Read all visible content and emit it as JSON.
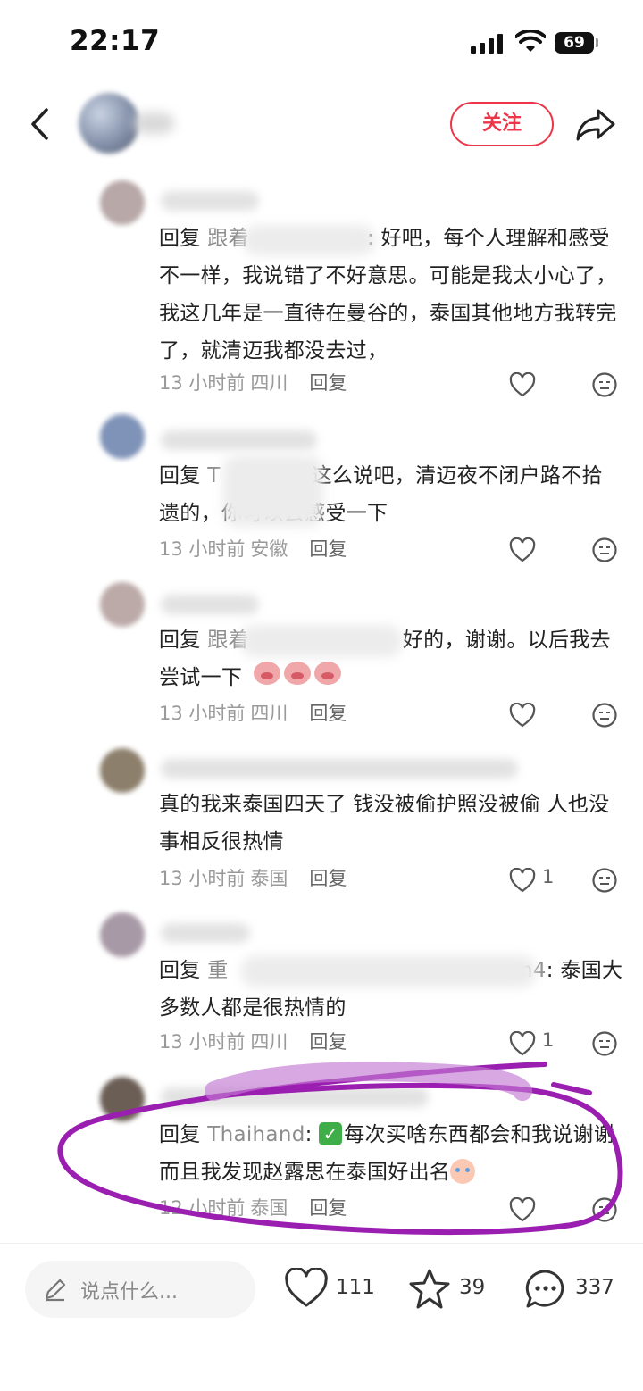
{
  "status_bar": {
    "time": "22:17",
    "battery": "69"
  },
  "header": {
    "follow_label": "关注"
  },
  "comments": [
    {
      "reply_prefix": "回复",
      "mention": "跟着",
      "text": ": 好吧，每个人理解和感受不一样，我说错了不好意思。可能是我太小心了，我这几年是一直待在曼谷的，泰国其他地方我转完了，就清迈我都没去过，",
      "time": "13 小时前",
      "location": "四川",
      "reply_label": "回复",
      "likes": ""
    },
    {
      "reply_prefix": "回复",
      "mention": "T",
      "text": "这么说吧，清迈夜不闭户路不拾遗的，你可以去感受一下",
      "time": "13 小时前",
      "location": "安徽",
      "reply_label": "回复",
      "likes": ""
    },
    {
      "reply_prefix": "回复",
      "mention": "跟着",
      "text": "好的，谢谢。以后我去尝试一下",
      "time": "13 小时前",
      "location": "四川",
      "reply_label": "回复",
      "likes": ""
    },
    {
      "reply_prefix": "",
      "mention": "",
      "text": "真的我来泰国四天了 钱没被偷护照没被偷 人也没事相反很热情",
      "time": "13 小时前",
      "location": "泰国",
      "reply_label": "回复",
      "likes": "1"
    },
    {
      "reply_prefix": "回复",
      "mention": "重",
      "mention_tail": "on4",
      "text": ": 泰国大多数人都是很热情的",
      "time": "13 小时前",
      "location": "四川",
      "reply_label": "回复",
      "likes": "1"
    },
    {
      "reply_prefix": "回复",
      "mention": "Thaihand",
      "text": "每次买啥东西都会和我说谢谢 而且我发现赵露思在泰国好出名",
      "time": "12 小时前",
      "location": "泰国",
      "reply_label": "回复",
      "likes": ""
    }
  ],
  "bottom_bar": {
    "input_placeholder": "说点什么...",
    "like_count": "111",
    "collect_count": "39",
    "comment_count": "337"
  },
  "colors": {
    "accent": "#ec3548",
    "highlight_ink": "#9a1fb0"
  }
}
